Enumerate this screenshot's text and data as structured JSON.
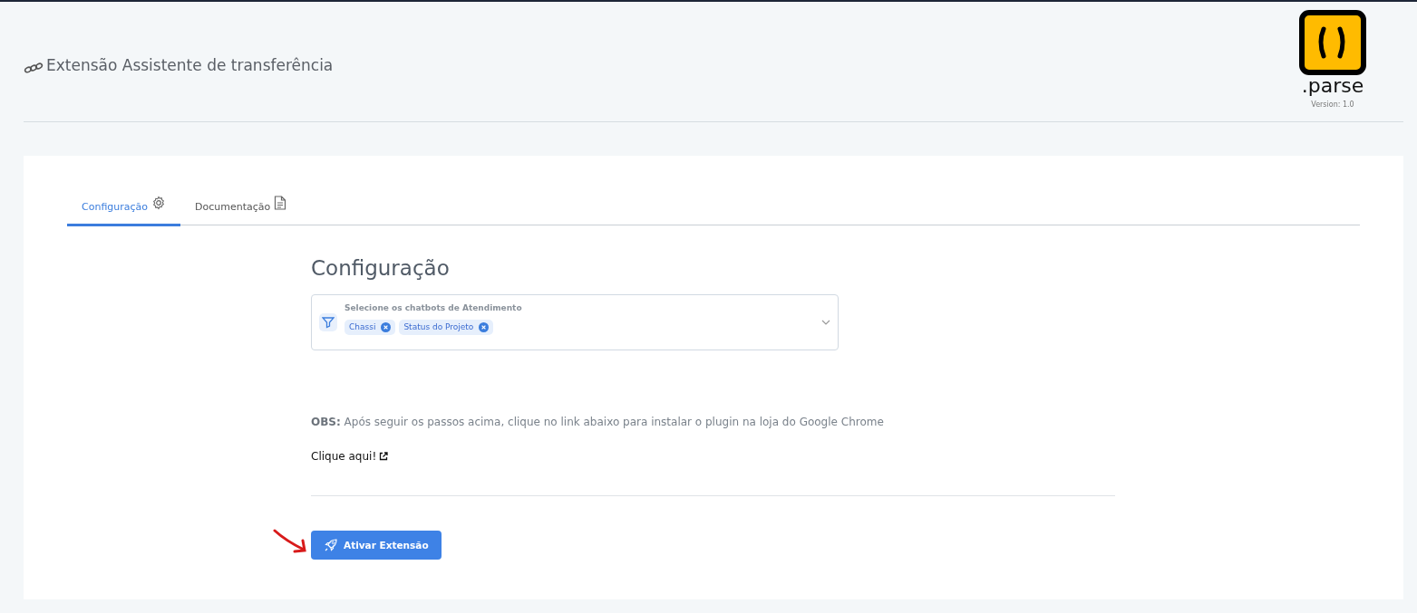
{
  "header": {
    "title": "Extensão Assistente de transferência",
    "logo_text": ".parse",
    "version": "Version: 1.0"
  },
  "tabs": [
    {
      "label": "Configuração",
      "kind": "gear",
      "selected": true
    },
    {
      "label": "Documentação",
      "kind": "document",
      "selected": false
    }
  ],
  "section": {
    "heading": "Configuração",
    "select": {
      "label": "Selecione os chatbots de Atendimento",
      "tags": [
        "Chassi",
        "Status do Projeto"
      ]
    },
    "note": "**OBS:** Após seguir os passos acima, clique no link abaixo para instalar o plugin na loja do Google Chrome",
    "link": "Clique aqui!"
  },
  "button": {
    "label": "Ativar Extensão"
  }
}
